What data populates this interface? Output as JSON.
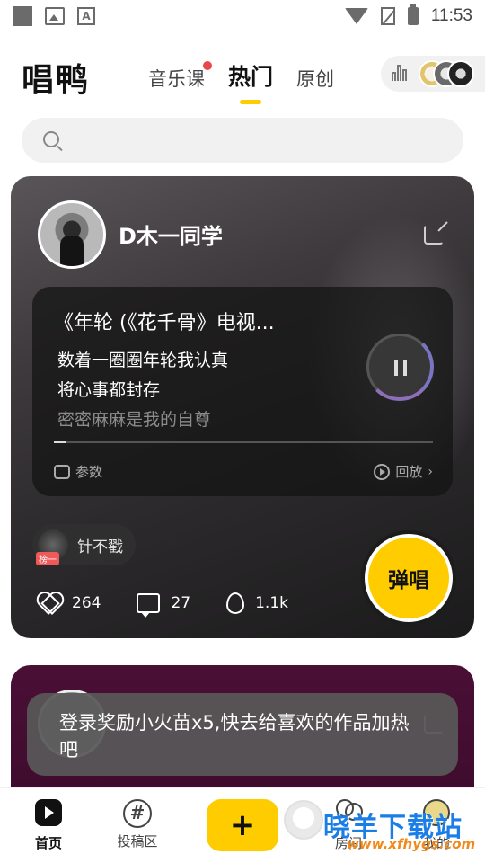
{
  "status_bar": {
    "time": "11:53",
    "left_icons": [
      "square-notification-icon",
      "image-icon",
      "a-notification-icon"
    ],
    "right_icons": [
      "wifi-icon",
      "no-sim-icon",
      "battery-charging-icon"
    ]
  },
  "header": {
    "logo": "唱鸭",
    "tabs": [
      {
        "label": "音乐课",
        "has_dot": true
      },
      {
        "label": "热门",
        "active": true
      },
      {
        "label": "原创"
      }
    ],
    "rank_icon": "ranking-bars-icon"
  },
  "search": {
    "placeholder": "",
    "icon": "search-icon"
  },
  "feed": {
    "card1": {
      "username": "D木一同学",
      "song_title": "《年轮 (《花千骨》电视...",
      "lyrics": [
        "数着一圈圈年轮我认真",
        "将心事都封存",
        "密密麻麻是我的自尊"
      ],
      "progress": 0.03,
      "params_label": "参数",
      "replay_label": "回放",
      "chip": {
        "badge": "榜一",
        "name": "针不戳"
      },
      "stats": {
        "likes": "264",
        "comments": "27",
        "heat": "1.1k"
      },
      "sing_label": "弹唱"
    }
  },
  "toast": {
    "text": "登录奖励小火苗x5,快去给喜欢的作品加热吧"
  },
  "bottom_nav": {
    "items": [
      {
        "label": "首页",
        "icon": "home-play-icon",
        "active": true
      },
      {
        "label": "投稿区",
        "icon": "hashtag-icon"
      },
      {
        "label": "房间",
        "icon": "room-icon"
      },
      {
        "label": "我的",
        "icon": "profile-icon"
      }
    ],
    "create_label": "+"
  },
  "watermark": {
    "text": "晓羊下载站",
    "url": "www.xfhygs.com"
  },
  "colors": {
    "accent": "#ffcc00",
    "badge_red": "#ee5a5a",
    "notification_dot": "#e94848"
  }
}
